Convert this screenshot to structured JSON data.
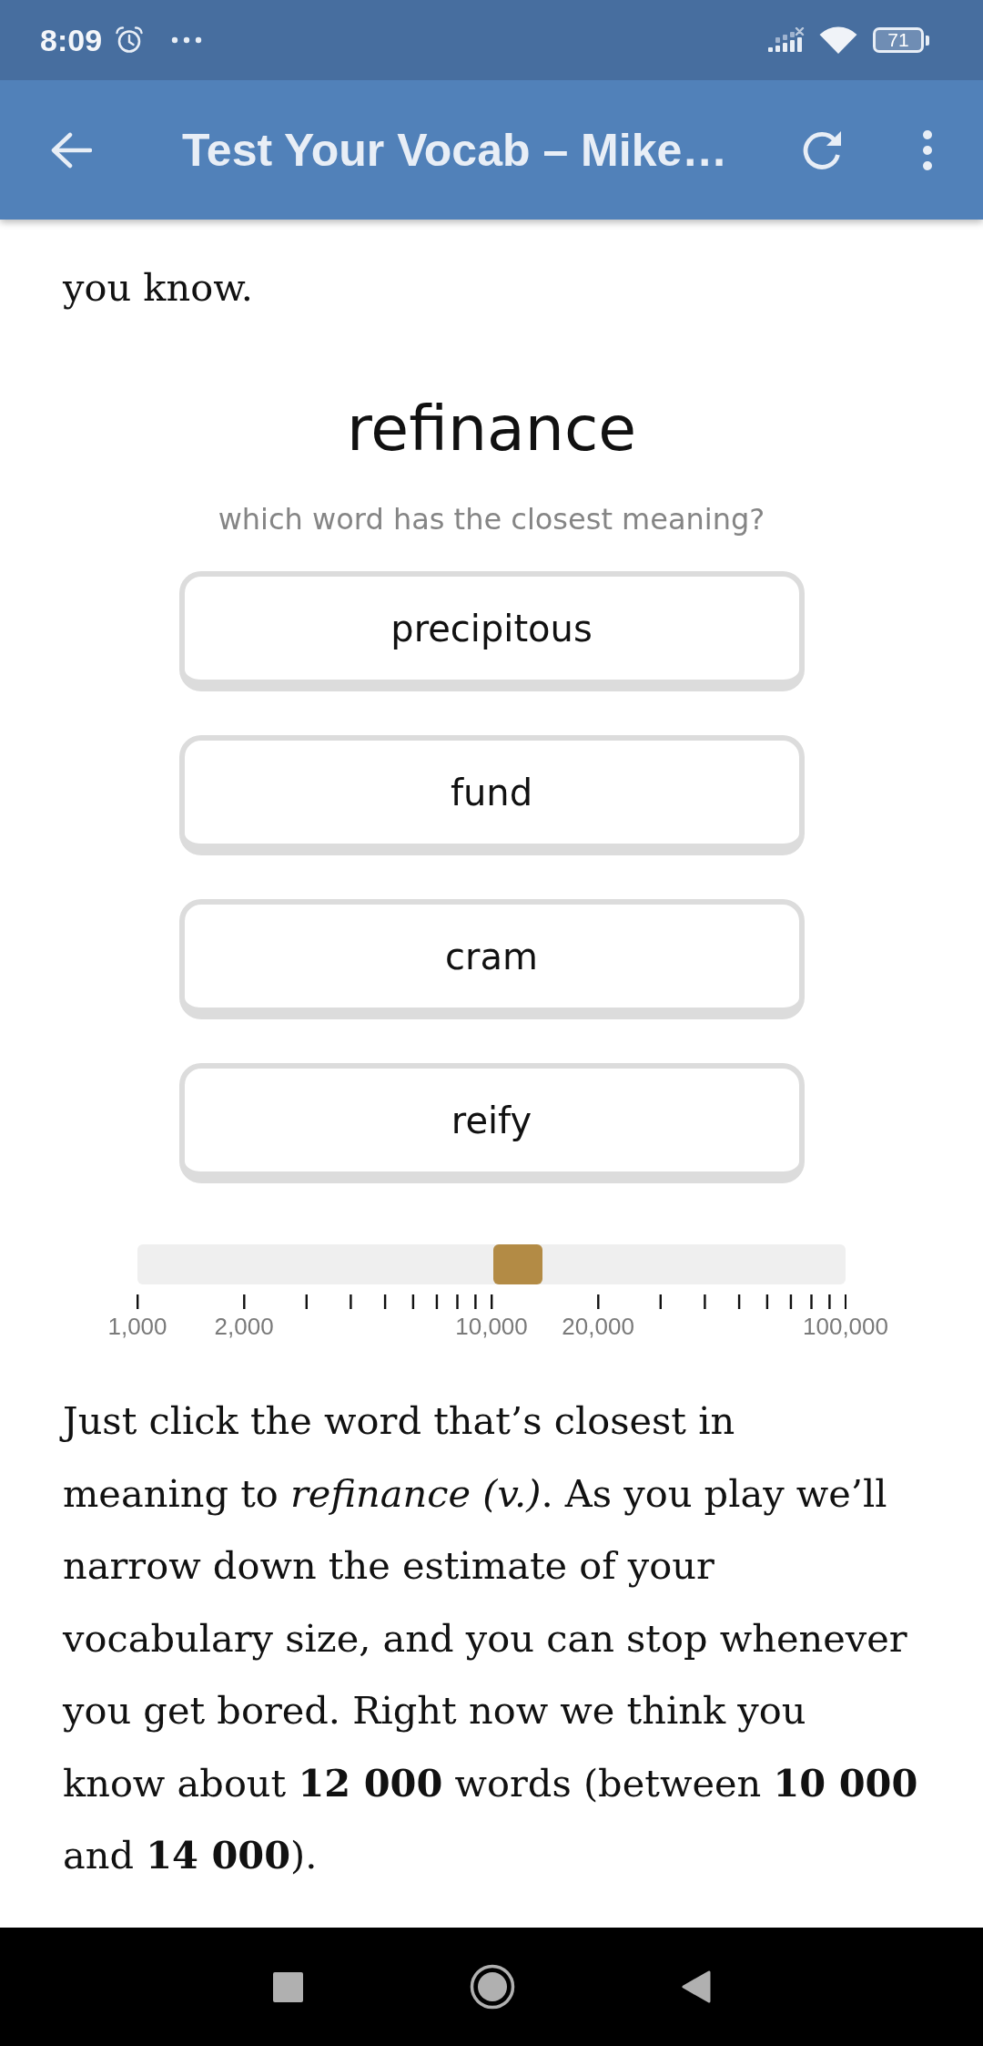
{
  "status_bar": {
    "time": "8:09",
    "battery": "71"
  },
  "app_bar": {
    "title": "Test Your Vocab – Mike…"
  },
  "intro": {
    "text": "you know."
  },
  "quiz": {
    "word": "refinance",
    "question": "which word has the closest meaning?",
    "options": [
      {
        "label": "precipitous"
      },
      {
        "label": "fund"
      },
      {
        "label": "cram"
      },
      {
        "label": "reify"
      }
    ]
  },
  "estimate": {
    "level": 0.537,
    "tick_labels": [
      "1,000",
      "2,000",
      "10,000",
      "20,000",
      "100,000"
    ]
  },
  "explanation": {
    "lines": [
      "Just click the word that’s closest in",
      "meaning to *refinance (v.)*. As you play we’ll",
      "narrow down the estimate of your",
      "vocabulary size, and you can stop whenever",
      "you get bored. Right now we think you",
      "know about **12 000** words (between **10 000**",
      "and **14 000**)."
    ]
  }
}
